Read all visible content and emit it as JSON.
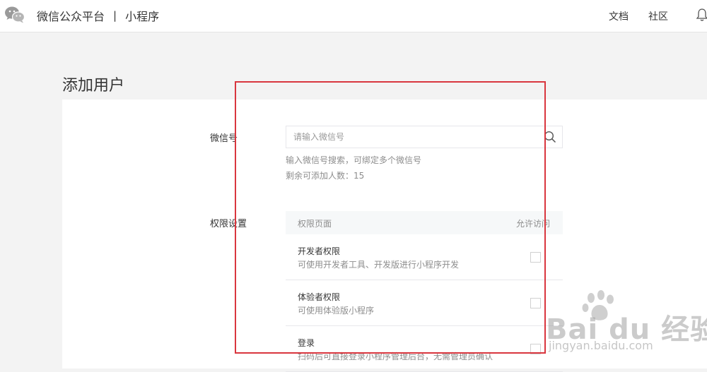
{
  "header": {
    "brand": "微信公众平台",
    "separator": "|",
    "product": "小程序",
    "links": {
      "docs": "文档",
      "community": "社区"
    },
    "logo_icon": "wechat-logo-icon",
    "notification_icon": "bell-icon"
  },
  "page": {
    "title": "添加用户"
  },
  "form": {
    "wechat_label": "微信号",
    "search_placeholder": "请输入微信号",
    "search_icon": "search-icon",
    "hint_search": "输入微信号搜索，可绑定多个微信号",
    "hint_remaining": "剩余可添加人数：15",
    "permission_label": "权限设置"
  },
  "permissions": {
    "header_page": "权限页面",
    "header_allow": "允许访问",
    "rows": [
      {
        "title": "开发者权限",
        "desc": "可使用开发者工具、开发版进行小程序开发",
        "checked": false
      },
      {
        "title": "体验者权限",
        "desc": "可使用体验版小程序",
        "checked": false
      },
      {
        "title": "登录",
        "desc": "扫码后可直接登录小程序管理后台，无需管理员确认",
        "checked": false
      }
    ]
  },
  "annotation": {
    "color": "#d9363e"
  },
  "watermark": {
    "main": "Bai du 经验",
    "sub": "jingyan.baidu.com"
  }
}
